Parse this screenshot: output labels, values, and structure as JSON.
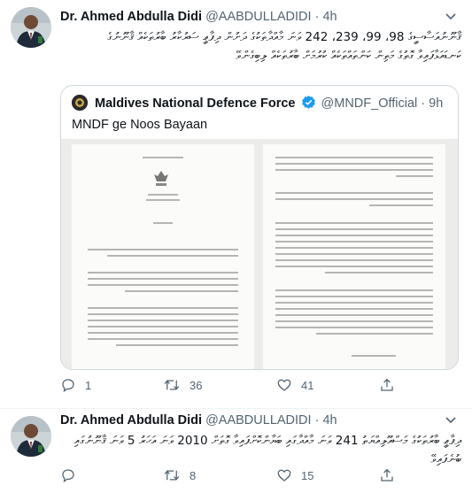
{
  "tweets": [
    {
      "author": "Dr. Ahmed Abdulla Didi",
      "handle": "@AABDULLADIDI",
      "time": "4h",
      "text": "ޤާނޫނުއަސާސީގެ 98، 99، 239، 242 ވަނަ މާއްދާތަކުގެ ދަށުން ދިފާޢީ ސަރުކާރު ބާރުތަކެއް ޤާނޫނުގެ ކަނޑައަޅާފައިވާ ގޮތުގެ މަތިން ކަންތައްތަކެއް ކުރުމަށް ބާރުތަކެއް ލިބިގެންވޭ",
      "quote": {
        "author": "Maldives National Defence Force",
        "handle": "@MNDF_Official",
        "time": "9h",
        "text": "MNDF ge Noos Bayaan"
      },
      "actions": {
        "replies": "1",
        "retweets": "36",
        "likes": "41"
      }
    },
    {
      "author": "Dr. Ahmed Abdulla Didi",
      "handle": "@AABDULLADIDI",
      "time": "4h",
      "text": "ދިފާޢީ ބާރުތަކުގެ މަސްއޫލިއްޔަތު 241 ވަނަ މާއްދާގައި ބަޔާންކޮށްފައިވާ ގޮތަށް 2010 ވަނަ އަހަރު 5 ވަނަ ޤާނޫނުގައި ބުނެފައިވޭ",
      "actions": {
        "replies": "",
        "retweets": "8",
        "likes": "15"
      }
    }
  ],
  "icons": {
    "more": "more-icon",
    "verified": "verified-badge-icon",
    "reply": "reply-icon",
    "retweet": "retweet-icon",
    "like": "like-icon",
    "share": "share-icon"
  },
  "colors": {
    "muted": "#536471",
    "verified": "#1d9bf0",
    "border": "#cfd9de"
  }
}
